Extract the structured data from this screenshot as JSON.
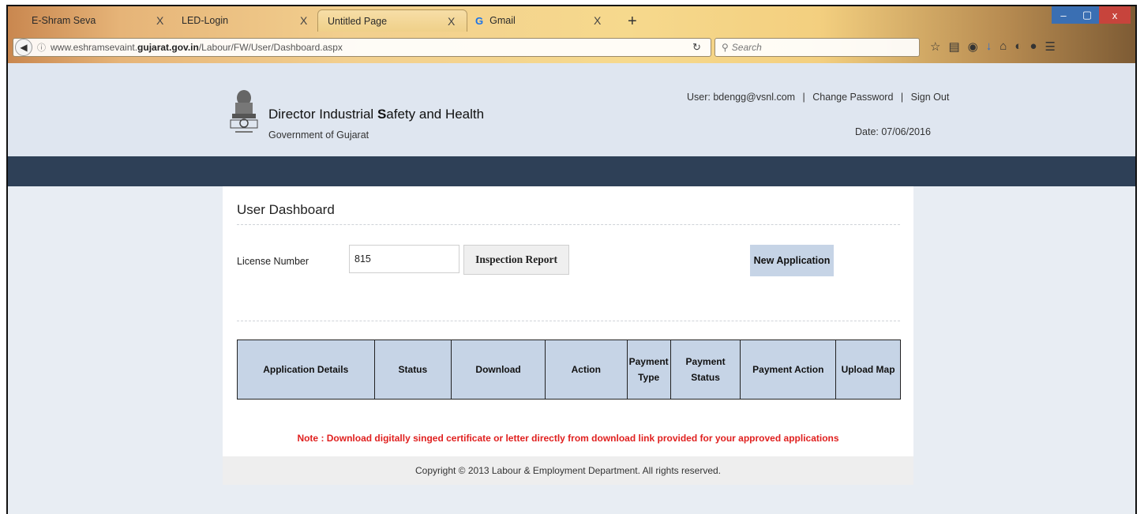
{
  "browser": {
    "tabs": [
      {
        "title": "E-Shram Seva",
        "close": "X"
      },
      {
        "title": "LED-Login",
        "close": "X"
      },
      {
        "title": "Untitled Page",
        "close": "X"
      },
      {
        "title": "Gmail",
        "close": "X"
      }
    ],
    "new_tab": "+",
    "url_prefix": "www.eshramsevaint.",
    "url_host": "gujarat.gov.in",
    "url_path": "/Labour/FW/User/Dashboard.aspx",
    "search_placeholder": "Search",
    "window_buttons": {
      "minimize": "–",
      "maximize": "▢",
      "close": "x"
    }
  },
  "header": {
    "org_title_part1": "Director Industrial ",
    "org_title_bold": "S",
    "org_title_part2": "afety and Health",
    "org_subtitle": "Government of Gujarat",
    "user_label": "User: bdengg@vsnl.com",
    "separator": "|",
    "change_password": "Change Password",
    "sign_out": "Sign Out",
    "date_label": "Date: 07/06/2016"
  },
  "main": {
    "title": "User Dashboard",
    "license_label": "License Number",
    "license_value": "815",
    "inspection_button": "Inspection Report",
    "new_application_button": "New Application",
    "columns": [
      "Application Details",
      "Status",
      "Download",
      "Action",
      "Payment Type",
      "Payment Status",
      "Payment Action",
      "Upload Map"
    ],
    "note": "Note : Download digitally singed certificate or letter directly from download link provided for your approved applications"
  },
  "footer": {
    "copyright": "Copyright © 2013 Labour & Employment Department. All rights reserved."
  },
  "colors": {
    "nav_bar": "#2e4057",
    "header_bg": "#dfe6f0",
    "table_header": "#c6d4e6",
    "note_red": "#e0201f"
  }
}
